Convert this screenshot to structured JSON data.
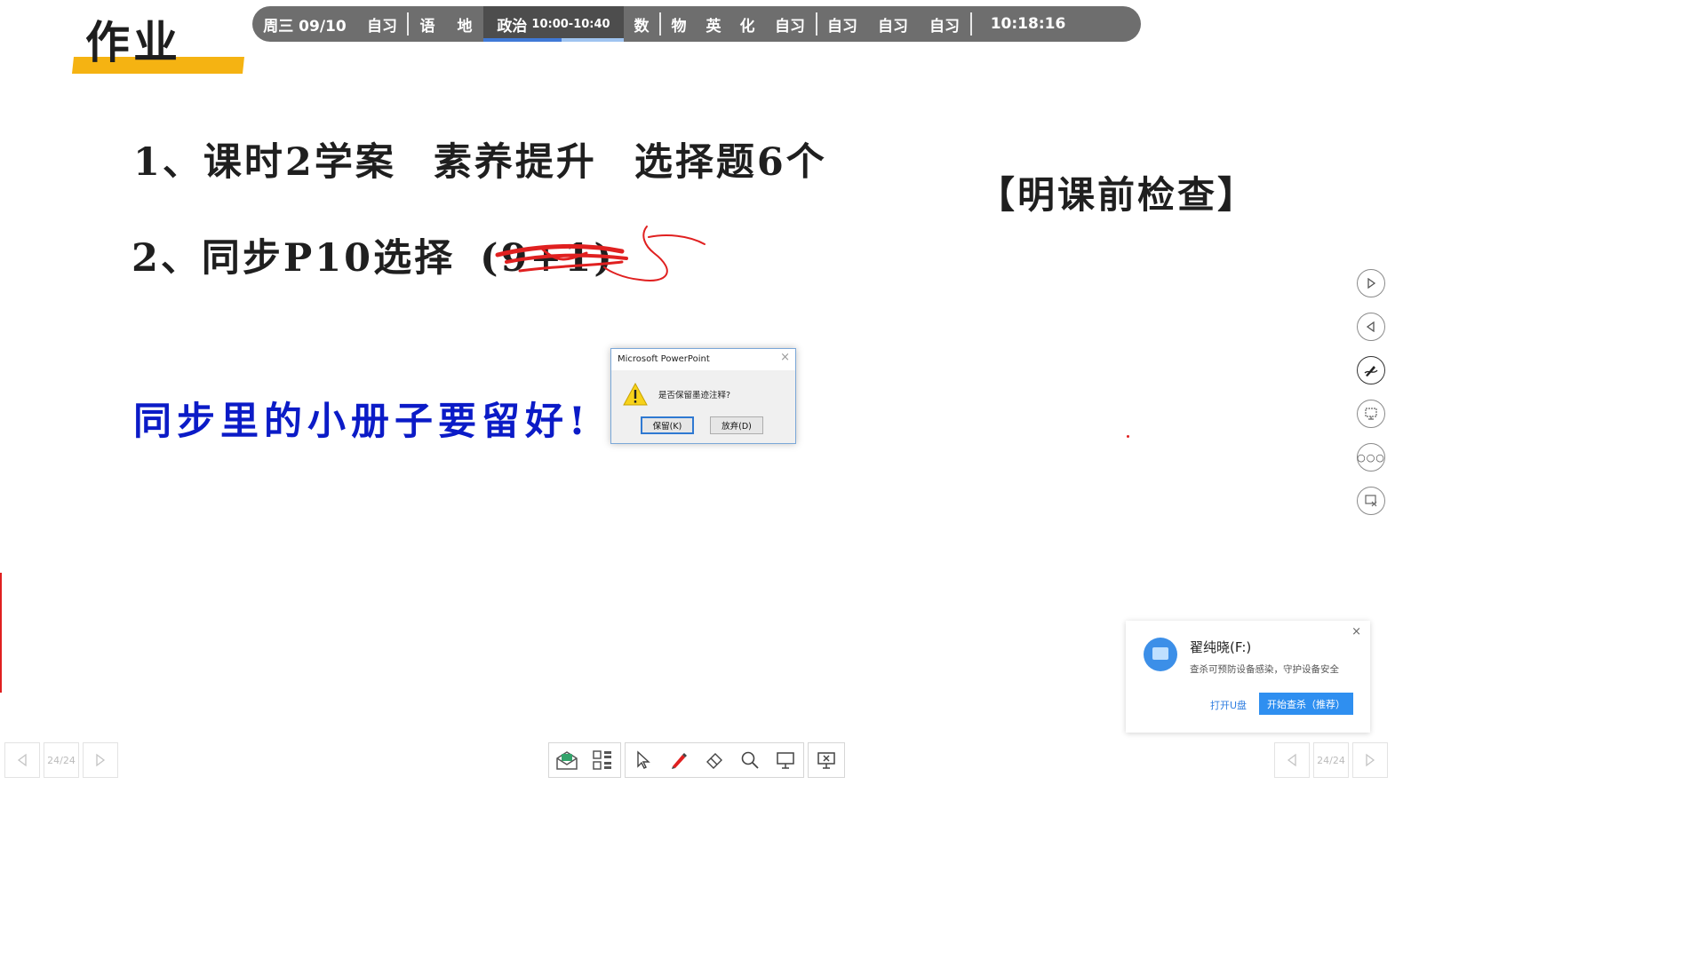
{
  "title": "作业",
  "schedule": {
    "day_date": "周三 09/10",
    "slots_a": [
      "自习"
    ],
    "slots_b": [
      "语",
      "地"
    ],
    "current_subject": "政治",
    "current_time": "10:00-10:40",
    "current_progress": 0.56,
    "slots_c": [
      "数"
    ],
    "slots_d": [
      "物",
      "英",
      "化",
      "自习"
    ],
    "slots_e": [
      "自习",
      "自习",
      "自习"
    ],
    "clock": "10:18:16"
  },
  "content": {
    "line1": {
      "num": "1、",
      "p1": "课时2学案",
      "p2": "素养提升",
      "p3": "选择题6个"
    },
    "line2": {
      "num": "2、",
      "p1": "同步P10选择",
      "struck": "(9+1)"
    },
    "note": "【明课前检查】",
    "reminder": "同步里的小册子要留好!"
  },
  "dialog": {
    "title": "Microsoft PowerPoint",
    "message": "是否保留墨迹注释?",
    "keep": "保留(K)",
    "discard": "放弃(D)"
  },
  "usb": {
    "title": "翟纯晓(F:)",
    "subtitle": "查杀可预防设备感染，守护设备安全",
    "open_link": "打开U盘",
    "scan_button": "开始查杀（推荐）"
  },
  "pager": {
    "left": "24/24",
    "right": "24/24"
  },
  "colors": {
    "accent_yellow": "#f5b312",
    "reminder_blue": "#0b1bc7",
    "ink_red": "#e02020"
  }
}
